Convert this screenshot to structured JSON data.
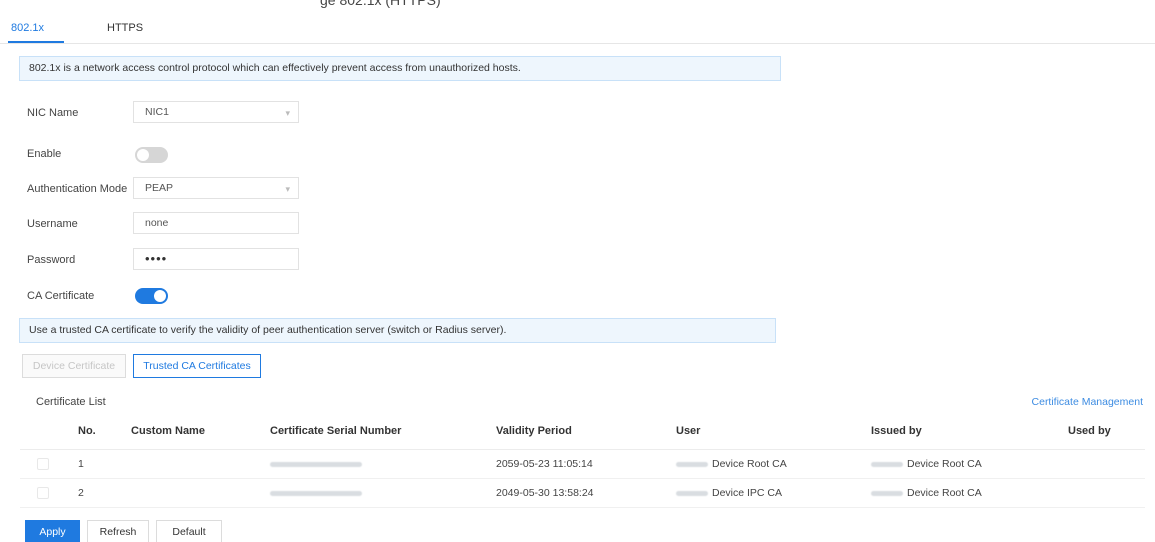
{
  "page": {
    "top_fragment": "ge 802.1x (HTTPS)"
  },
  "tabs": [
    {
      "label": "802.1x",
      "active": true
    },
    {
      "label": "HTTPS",
      "active": false
    }
  ],
  "info": {
    "top": "802.1x is a network access control protocol which can effectively prevent access from unauthorized hosts.",
    "ca": "Use a trusted CA certificate to verify the validity of peer authentication server (switch or Radius server)."
  },
  "form": {
    "nic_label": "NIC Name",
    "nic_value": "NIC1",
    "enable_label": "Enable",
    "enable_on": false,
    "auth_label": "Authentication Mode",
    "auth_value": "PEAP",
    "username_label": "Username",
    "username_value": "none",
    "password_label": "Password",
    "password_value": "••••",
    "ca_label": "CA Certificate",
    "ca_on": true
  },
  "subtabs": {
    "device": "Device Certificate",
    "trusted": "Trusted CA Certificates"
  },
  "certificates": {
    "title": "Certificate List",
    "manage_link": "Certificate Management",
    "columns": [
      "No.",
      "Custom Name",
      "Certificate Serial Number",
      "Validity Period",
      "User",
      "Issued by",
      "Used by"
    ],
    "rows": [
      {
        "no": "1",
        "custom_name": "",
        "validity": "2059-05-23 11:05:14",
        "user": "Device Root CA",
        "issued_by": "Device Root CA",
        "used_by": ""
      },
      {
        "no": "2",
        "custom_name": "",
        "validity": "2049-05-30 13:58:24",
        "user": "Device IPC CA",
        "issued_by": "Device Root CA",
        "used_by": ""
      }
    ]
  },
  "buttons": {
    "apply": "Apply",
    "refresh": "Refresh",
    "default": "Default"
  },
  "colors": {
    "accent": "#1f7ae0",
    "info_bg": "#eef6fd",
    "link": "#3d8ce2"
  }
}
